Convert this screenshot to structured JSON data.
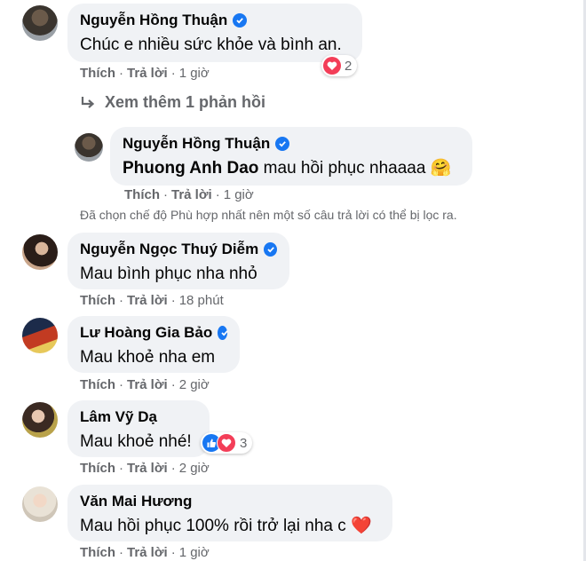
{
  "comments": [
    {
      "author": "Nguyễn Hồng Thuận",
      "verified": true,
      "text": "Chúc e nhiều sức khỏe và bình an.",
      "like": "Thích",
      "reply": "Trả lời",
      "time": "1 giờ",
      "reaction_count": "2"
    },
    {
      "author": "Nguyễn Ngọc Thuý Diễm",
      "verified": true,
      "text": "Mau bình phục nha nhỏ",
      "like": "Thích",
      "reply": "Trả lời",
      "time": "18 phút"
    },
    {
      "author": "Lư Hoàng Gia Bảo",
      "verified": true,
      "text": "Mau khoẻ nha em",
      "like": "Thích",
      "reply": "Trả lời",
      "time": "2 giờ"
    },
    {
      "author": "Lâm Vỹ Dạ",
      "verified": false,
      "text": "Mau khoẻ nhé!",
      "like": "Thích",
      "reply": "Trả lời",
      "time": "2 giờ",
      "reaction_count": "3"
    },
    {
      "author": "Văn Mai Hương",
      "verified": false,
      "text": "Mau hồi phục 100% rồi trở lại nha c ❤️",
      "like": "Thích",
      "reply": "Trả lời",
      "time": "1 giờ"
    }
  ],
  "more_replies": "Xem thêm 1 phản hồi",
  "reply": {
    "author": "Nguyễn Hồng Thuận",
    "verified": true,
    "mention": "Phuong Anh Dao",
    "text": " mau hồi phục nhaaaa 🤗",
    "like": "Thích",
    "reply": "Trả lời",
    "time": "1 giờ"
  },
  "filter_notice": "Đã chọn chế độ Phù hợp nhất nên một số câu trả lời có thể bị lọc ra.",
  "colors": {
    "bubble": "#f0f2f5",
    "verified": "#1877f2",
    "meta": "#65676b",
    "love": "#f33e58",
    "like": "#1877f2"
  }
}
